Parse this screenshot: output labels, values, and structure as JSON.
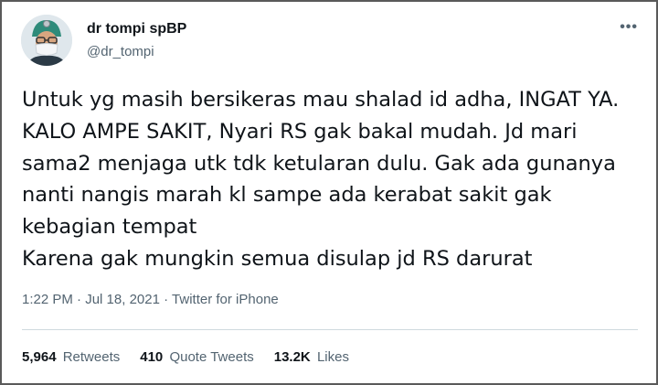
{
  "author": {
    "display_name": "dr tompi spBP",
    "handle": "@dr_tompi"
  },
  "tweet": {
    "text": "Untuk yg masih bersikeras mau shalad id adha, INGAT YA. KALO AMPE SAKIT, Nyari RS gak bakal mudah. Jd mari sama2 menjaga utk tdk ketularan dulu. Gak ada gunanya nanti nangis marah kl sampe ada kerabat sakit gak kebagian tempat\nKarena gak mungkin semua disulap jd RS darurat",
    "time": "1:22 PM",
    "date": "Jul 18, 2021",
    "source": "Twitter for iPhone"
  },
  "stats": {
    "retweets_count": "5,964",
    "retweets_label": "Retweets",
    "quotes_count": "410",
    "quotes_label": "Quote Tweets",
    "likes_count": "13.2K",
    "likes_label": "Likes"
  },
  "icons": {
    "more": "more-horizontal-icon",
    "avatar": "user-avatar"
  },
  "colors": {
    "text_primary": "#0f1419",
    "text_secondary": "#536471",
    "divider": "#cfd9de"
  }
}
